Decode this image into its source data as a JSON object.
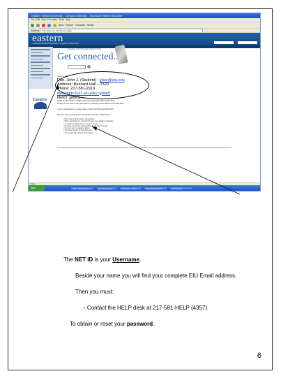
{
  "screenshot": {
    "window_title": "Eastern Illinois University - Campus Directory - Microsoft Internet Explorer",
    "menu_items": [
      "File",
      "Edit",
      "View",
      "Favorites",
      "Tools",
      "Help"
    ],
    "toolbar_text": "Back · Search · Favorites · Media",
    "address_label": "Address",
    "address_url": "http://www.eiu.edu/directory.php",
    "site_logo": "eastern",
    "site_subtitle": "EASTERN ILLINOIS UNIVERSITY | CAMPUS DIRECTORY",
    "search_label": "SEARCH EIU/PHONE DIRECTORY",
    "page_heading": "Get connected...",
    "hint_text": "Search results:",
    "result": {
      "name_line": "Doe, John J.  (Student)  -",
      "email": "jjdoe@eiu.edu",
      "address_line": "Address:  Buzzard Hall – 2320",
      "phone_line": "Phone:  217-581-2919",
      "web_link": "www.http://ux1.eiu.edu/~jjdoe5",
      "netid_line": "NetID:  jjdoe5"
    },
    "logo_text": "Eastern",
    "paragraphs": [
      "Students with problems should contact the Registration Office at 581-3511.",
      "Employees can correct their information by contacting Human Resources at 581-3463.",
      "If your e-mail address is wrong, please contact the Help Desk (581-4357).",
      "Fill in the name of employee for any Student, Faculty, or Staff at EIU."
    ],
    "bullets": [
      "Don't enter a whole name - just a portion.",
      "When searching for a person's full name use Lastname, Firstname.",
      "To search for partial names, use the * symbol.",
      "If you are unsure of a name spelling, try the first few letters.",
      "You must enter at least two letters.",
      "You cannot search by first name only.",
      "Your search will return up to 50 entries."
    ],
    "status_text": "Done",
    "taskbar": {
      "start": "start",
      "tasks": [
        "Inbox - Microsoft Ou...",
        "EIU Net Services",
        "Document1 - Micro...",
        "Microsoft PowerPoint",
        "EIU Directory"
      ]
    }
  },
  "instructions": {
    "netid_prefix": "The ",
    "netid_term": "NET ID",
    "netid_middle": " is your ",
    "netid_username": "Username",
    "netid_suffix": ".",
    "email_line": "Beside your name you will find your complete EIU Email address.",
    "then_line": "Then you must:",
    "helpdesk_line": "- Contact the HELP desk at 217-581-HELP (4357)",
    "reset_prefix": "To obtain or reset your ",
    "reset_term": "password",
    "reset_suffix": "."
  },
  "page_number": "6",
  "colors": {
    "eiu_blue": "#1e5fa8",
    "link_blue": "#1a3fd0",
    "xp_taskbar": "#1f56c0"
  }
}
